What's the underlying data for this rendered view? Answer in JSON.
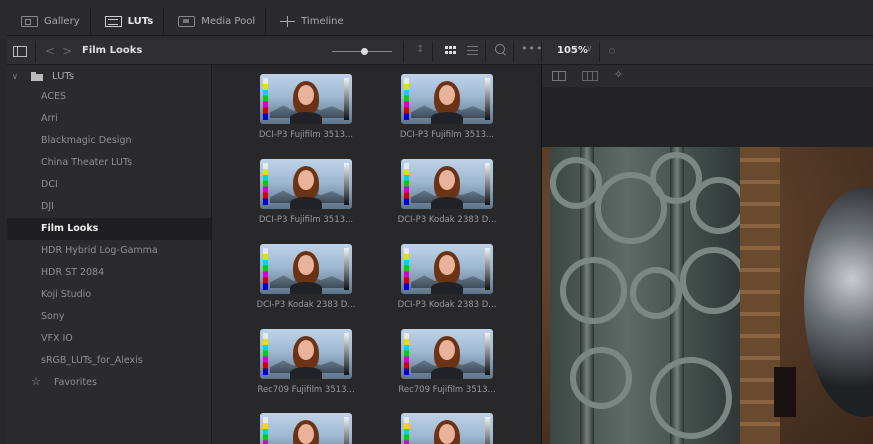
{
  "tabs": [
    {
      "label": "Gallery",
      "icon": "gallery-icon",
      "active": false
    },
    {
      "label": "LUTs",
      "icon": "luts-icon",
      "active": true
    },
    {
      "label": "Media Pool",
      "icon": "media-pool-icon",
      "active": false
    },
    {
      "label": "Timeline",
      "icon": "timeline-icon",
      "active": false
    }
  ],
  "toolbar": {
    "title": "Film Looks",
    "back": "<",
    "forward": ">",
    "sort": "↕",
    "more": "•••",
    "zoom": "105%",
    "zoom_chevron": "∨"
  },
  "sidebar": {
    "root": {
      "label": "LUTs",
      "chevron": "∨"
    },
    "items": [
      {
        "label": "ACES",
        "selected": false
      },
      {
        "label": "Arri",
        "selected": false
      },
      {
        "label": "Blackmagic Design",
        "selected": false
      },
      {
        "label": "China Theater LUTs",
        "selected": false
      },
      {
        "label": "DCI",
        "selected": false
      },
      {
        "label": "DJI",
        "selected": false
      },
      {
        "label": "Film Looks",
        "selected": true
      },
      {
        "label": "HDR Hybrid Log-Gamma",
        "selected": false
      },
      {
        "label": "HDR ST 2084",
        "selected": false
      },
      {
        "label": "Koji Studio",
        "selected": false
      },
      {
        "label": "Sony",
        "selected": false
      },
      {
        "label": "VFX IO",
        "selected": false
      },
      {
        "label": "sRGB_LUTs_for_Alexis",
        "selected": false
      }
    ],
    "favorites": {
      "label": "Favorites",
      "icon": "star-icon"
    }
  },
  "luts": [
    {
      "caption": "DCI-P3 Fujifilm 3513..."
    },
    {
      "caption": "DCI-P3 Fujifilm 3513..."
    },
    {
      "caption": "DCI-P3 Fujifilm 3513..."
    },
    {
      "caption": "DCI-P3 Kodak 2383 D..."
    },
    {
      "caption": "DCI-P3 Kodak 2383 D..."
    },
    {
      "caption": "DCI-P3 Kodak 2383 D..."
    },
    {
      "caption": "Rec709 Fujifilm 3513..."
    },
    {
      "caption": "Rec709 Fujifilm 3513..."
    },
    {
      "caption": ""
    },
    {
      "caption": ""
    }
  ],
  "viewer": {
    "tools": [
      "single-viewer-icon",
      "split-viewer-icon",
      "magic-wand-icon"
    ],
    "wand": "✧"
  }
}
